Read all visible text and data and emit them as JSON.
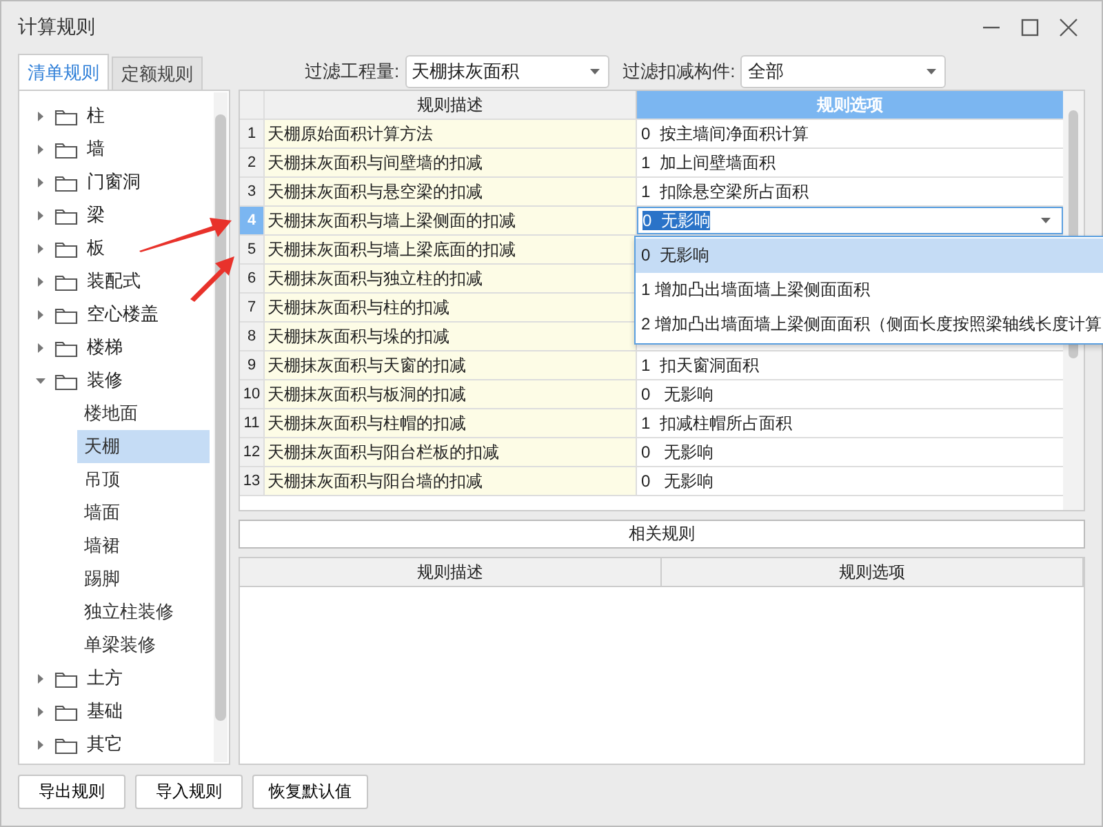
{
  "window": {
    "title": "计算规则"
  },
  "tabs": [
    {
      "label": "清单规则",
      "selected": true
    },
    {
      "label": "定额规则",
      "selected": false
    }
  ],
  "filters": [
    {
      "label": "过滤工程量:",
      "value": "天棚抹灰面积"
    },
    {
      "label": "过滤扣减构件:",
      "value": "全部"
    }
  ],
  "tree": [
    {
      "label": "柱",
      "expanded": false,
      "selected": false
    },
    {
      "label": "墙",
      "expanded": false,
      "selected": false
    },
    {
      "label": "门窗洞",
      "expanded": false,
      "selected": false
    },
    {
      "label": "梁",
      "expanded": false,
      "selected": false
    },
    {
      "label": "板",
      "expanded": false,
      "selected": false
    },
    {
      "label": "装配式",
      "expanded": false,
      "selected": false
    },
    {
      "label": "空心楼盖",
      "expanded": false,
      "selected": false
    },
    {
      "label": "楼梯",
      "expanded": false,
      "selected": false
    },
    {
      "label": "装修",
      "expanded": true,
      "selected": false,
      "children": [
        {
          "label": "楼地面",
          "selected": false
        },
        {
          "label": "天棚",
          "selected": true
        },
        {
          "label": "吊顶",
          "selected": false
        },
        {
          "label": "墙面",
          "selected": false
        },
        {
          "label": "墙裙",
          "selected": false
        },
        {
          "label": "踢脚",
          "selected": false
        },
        {
          "label": "独立柱装修",
          "selected": false
        },
        {
          "label": "单梁装修",
          "selected": false
        }
      ]
    },
    {
      "label": "土方",
      "expanded": false,
      "selected": false
    },
    {
      "label": "基础",
      "expanded": false,
      "selected": false
    },
    {
      "label": "其它",
      "expanded": false,
      "selected": false
    }
  ],
  "rules_table": {
    "columns": [
      "规则描述",
      "规则选项"
    ],
    "rows": [
      {
        "number": "1",
        "description": "天棚原始面积计算方法",
        "option": "0  按主墙间净面积计算",
        "selected": false
      },
      {
        "number": "2",
        "description": "天棚抹灰面积与间壁墙的扣减",
        "option": "1  加上间壁墙面积",
        "selected": false
      },
      {
        "number": "3",
        "description": "天棚抹灰面积与悬空梁的扣减",
        "option": "1  扣除悬空梁所占面积",
        "selected": false
      },
      {
        "number": "4",
        "description": "天棚抹灰面积与墙上梁侧面的扣减",
        "option": "0  无影响",
        "selected": true
      },
      {
        "number": "5",
        "description": "天棚抹灰面积与墙上梁底面的扣减",
        "selected": false
      },
      {
        "number": "6",
        "description": "天棚抹灰面积与独立柱的扣减",
        "selected": false
      },
      {
        "number": "7",
        "description": "天棚抹灰面积与柱的扣减",
        "selected": false
      },
      {
        "number": "8",
        "description": "天棚抹灰面积与垛的扣减",
        "selected": false
      },
      {
        "number": "9",
        "description": "天棚抹灰面积与天窗的扣减",
        "option": "1  扣天窗洞面积",
        "selected": false
      },
      {
        "number": "10",
        "description": "天棚抹灰面积与板洞的扣减",
        "option": "0   无影响",
        "selected": false
      },
      {
        "number": "11",
        "description": "天棚抹灰面积与柱帽的扣减",
        "option": "1  扣减柱帽所占面积",
        "selected": false
      },
      {
        "number": "12",
        "description": "天棚抹灰面积与阳台栏板的扣减",
        "option": "0   无影响",
        "selected": false
      },
      {
        "number": "13",
        "description": "天棚抹灰面积与阳台墙的扣减",
        "option": "0   无影响",
        "selected": false
      }
    ]
  },
  "dropdown": [
    {
      "label": "0  无影响",
      "selected": true
    },
    {
      "label": "1 增加凸出墙面墙上梁侧面面积",
      "selected": false
    },
    {
      "label": "2 增加凸出墙面墙上梁侧面面积（侧面长度按照梁轴线长度计算",
      "selected": false
    }
  ],
  "related": {
    "title": "相关规则",
    "columns": [
      "规则描述",
      "规则选项"
    ]
  },
  "buttons": [
    "导出规则",
    "导入规则",
    "恢复默认值"
  ]
}
